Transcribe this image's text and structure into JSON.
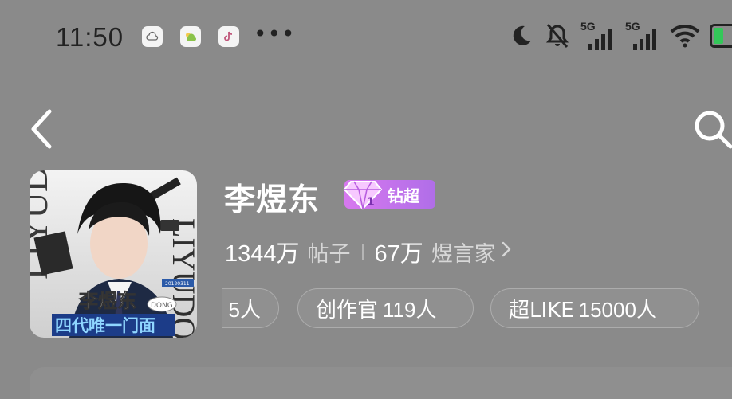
{
  "status_bar": {
    "time": "11:50",
    "notifications": [
      "cloud-icon",
      "weather-icon",
      "douyin-icon"
    ],
    "more": "•••",
    "signal_1_label": "5G",
    "signal_2_label": "5G",
    "icons": [
      "moon-icon",
      "mute-bell-icon",
      "signal-5g-icon",
      "signal-5g-icon",
      "wifi-icon",
      "battery-charging-icon"
    ]
  },
  "nav": {
    "back": "chevron-left-icon",
    "search": "search-icon"
  },
  "profile": {
    "name": "李煜东",
    "badge": "钻超",
    "avatar_texts": {
      "name": "李煜东",
      "slogan": "四代唯一门面",
      "side": "LIYUDONG",
      "tag": "DONG"
    },
    "stats": [
      {
        "value": "1344万",
        "label": "帖子"
      },
      {
        "value": "67万",
        "label": "煜言家"
      }
    ],
    "tags": [
      {
        "label": "",
        "value": "5人"
      },
      {
        "label": "创作官",
        "value": "119人"
      },
      {
        "label": "超LIKE",
        "value": "15000人"
      }
    ]
  },
  "colors": {
    "background": "#8a8a8a",
    "badge_gradient_start": "#d778ef",
    "badge_gradient_end": "#b06ee8",
    "battery_green": "#34c759"
  }
}
